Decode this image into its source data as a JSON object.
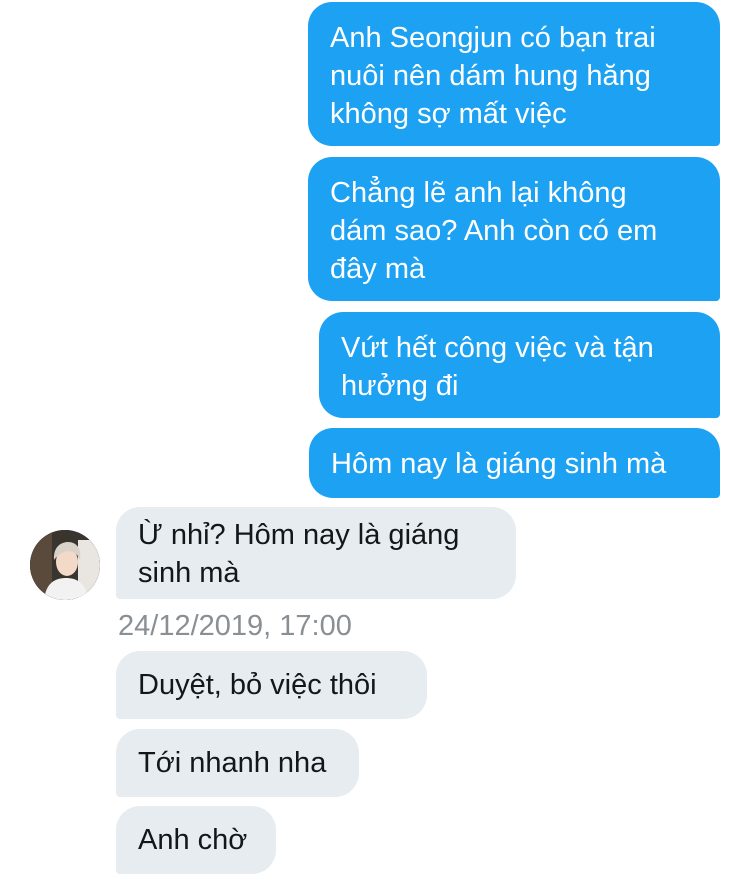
{
  "conversation": {
    "messages": [
      {
        "direction": "sent",
        "text": "Anh Seongjun có bạn trai\nnuôi nên dám hung hăng\nkhông sợ mất việc"
      },
      {
        "direction": "sent",
        "text": "Chẳng lẽ anh lại không\ndám sao? Anh còn có em\nđây mà"
      },
      {
        "direction": "sent",
        "text": "Vứt hết công việc và tận\nhưởng đi"
      },
      {
        "direction": "sent",
        "text": "Hôm nay là giáng sinh mà"
      },
      {
        "direction": "received",
        "text": "Ừ nhỉ? Hôm nay là giáng\nsinh mà"
      },
      {
        "direction": "received",
        "text": "Duyệt, bỏ việc thôi"
      },
      {
        "direction": "received",
        "text": "Tới nhanh nha"
      },
      {
        "direction": "received",
        "text": "Anh chờ"
      }
    ],
    "timestamp": "24/12/2019, 17:00",
    "avatar_icon": "user-avatar-photo"
  },
  "colors": {
    "sent_bubble": "#1da1f2",
    "sent_text": "#ffffff",
    "received_bubble": "#e6ecf0",
    "received_text": "#14171a",
    "timestamp_text": "#8a8f94"
  }
}
